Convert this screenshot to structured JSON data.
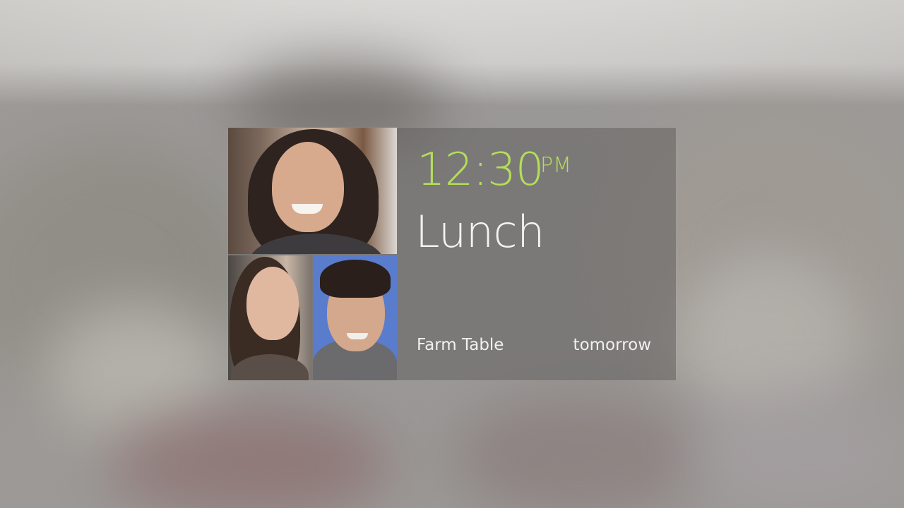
{
  "card": {
    "time": "12:30",
    "meridiem": "PM",
    "title": "Lunch",
    "location": "Farm Table",
    "when": "tomorrow"
  },
  "colors": {
    "time_accent": "#b4dd5a",
    "card_glass": "rgba(98,96,94,0.55)",
    "text_primary": "#f3f3f1"
  },
  "attendees": [
    {
      "icon": "person-photo-woman-smiling"
    },
    {
      "icon": "person-photo-woman"
    },
    {
      "icon": "person-photo-man-smiling"
    }
  ]
}
